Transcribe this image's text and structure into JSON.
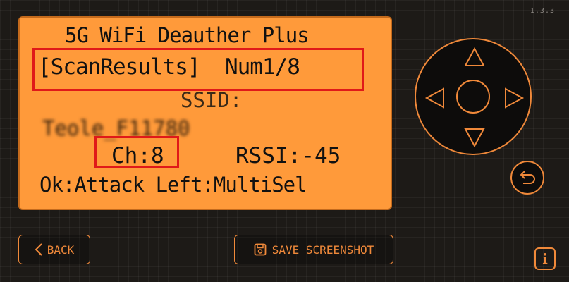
{
  "app": {
    "version": "1.3.3"
  },
  "screen": {
    "title": "5G WiFi Deauther Plus",
    "scan_label": "[ScanResults]",
    "num": "Num1/8",
    "ssid_label": "SSID:",
    "ssid_value": "Teole_F11780",
    "channel": "Ch:8",
    "rssi": "RSSI:-45",
    "ok_hint": "Ok:Attack Left:MultiSel"
  },
  "buttons": {
    "back": "BACK",
    "save_screenshot": "SAVE SCREENSHOT"
  },
  "icons": {
    "back": "chevron-left-icon",
    "save": "save-screenshot-icon",
    "up": "arrow-up-icon",
    "down": "arrow-down-icon",
    "left": "arrow-left-icon",
    "right": "arrow-right-icon",
    "return": "return-icon",
    "info": "info-icon"
  },
  "colors": {
    "screen_bg": "#ff9a3a",
    "accent": "#f0893a",
    "highlight": "#e01919",
    "background": "#1d1a17"
  }
}
